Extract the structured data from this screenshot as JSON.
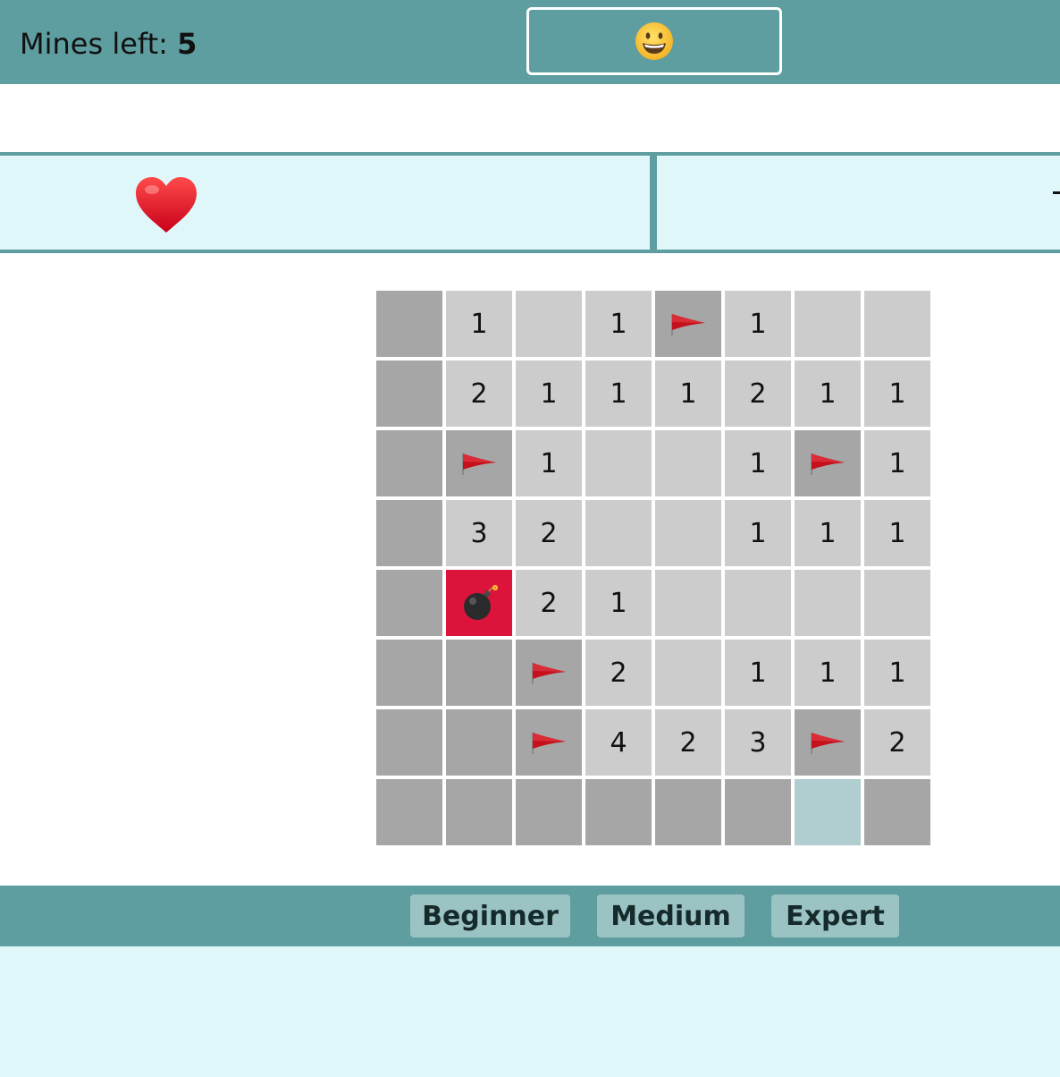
{
  "header": {
    "mines_left_label": "Mines left:",
    "mines_left_count": "5",
    "face_icon": "grinning-face-icon"
  },
  "status": {
    "lives_icon": "heart-icon",
    "lives": 1
  },
  "board": {
    "rows": 8,
    "cols": 8,
    "cells": [
      [
        {
          "s": "hidden",
          "v": ""
        },
        {
          "s": "revealed",
          "v": "1"
        },
        {
          "s": "revealed",
          "v": ""
        },
        {
          "s": "revealed",
          "v": "1"
        },
        {
          "s": "flag",
          "v": ""
        },
        {
          "s": "revealed",
          "v": "1"
        },
        {
          "s": "revealed",
          "v": ""
        },
        {
          "s": "revealed",
          "v": ""
        }
      ],
      [
        {
          "s": "hidden",
          "v": ""
        },
        {
          "s": "revealed",
          "v": "2"
        },
        {
          "s": "revealed",
          "v": "1"
        },
        {
          "s": "revealed",
          "v": "1"
        },
        {
          "s": "revealed",
          "v": "1"
        },
        {
          "s": "revealed",
          "v": "2"
        },
        {
          "s": "revealed",
          "v": "1"
        },
        {
          "s": "revealed",
          "v": "1"
        }
      ],
      [
        {
          "s": "hidden",
          "v": ""
        },
        {
          "s": "flag",
          "v": ""
        },
        {
          "s": "revealed",
          "v": "1"
        },
        {
          "s": "revealed",
          "v": ""
        },
        {
          "s": "revealed",
          "v": ""
        },
        {
          "s": "revealed",
          "v": "1"
        },
        {
          "s": "flag",
          "v": ""
        },
        {
          "s": "revealed",
          "v": "1"
        }
      ],
      [
        {
          "s": "hidden",
          "v": ""
        },
        {
          "s": "revealed",
          "v": "3"
        },
        {
          "s": "revealed",
          "v": "2"
        },
        {
          "s": "revealed",
          "v": ""
        },
        {
          "s": "revealed",
          "v": ""
        },
        {
          "s": "revealed",
          "v": "1"
        },
        {
          "s": "revealed",
          "v": "1"
        },
        {
          "s": "revealed",
          "v": "1"
        }
      ],
      [
        {
          "s": "hidden",
          "v": ""
        },
        {
          "s": "exploded",
          "v": ""
        },
        {
          "s": "revealed",
          "v": "2"
        },
        {
          "s": "revealed",
          "v": "1"
        },
        {
          "s": "revealed",
          "v": ""
        },
        {
          "s": "revealed",
          "v": ""
        },
        {
          "s": "revealed",
          "v": ""
        },
        {
          "s": "revealed",
          "v": ""
        }
      ],
      [
        {
          "s": "hidden",
          "v": ""
        },
        {
          "s": "hidden",
          "v": ""
        },
        {
          "s": "flag",
          "v": ""
        },
        {
          "s": "revealed",
          "v": "2"
        },
        {
          "s": "revealed",
          "v": ""
        },
        {
          "s": "revealed",
          "v": "1"
        },
        {
          "s": "revealed",
          "v": "1"
        },
        {
          "s": "revealed",
          "v": "1"
        }
      ],
      [
        {
          "s": "hidden",
          "v": ""
        },
        {
          "s": "hidden",
          "v": ""
        },
        {
          "s": "flag",
          "v": ""
        },
        {
          "s": "revealed",
          "v": "4"
        },
        {
          "s": "revealed",
          "v": "2"
        },
        {
          "s": "revealed",
          "v": "3"
        },
        {
          "s": "flag",
          "v": ""
        },
        {
          "s": "revealed",
          "v": "2"
        }
      ],
      [
        {
          "s": "hidden",
          "v": ""
        },
        {
          "s": "hidden",
          "v": ""
        },
        {
          "s": "hidden",
          "v": ""
        },
        {
          "s": "hidden",
          "v": ""
        },
        {
          "s": "hidden",
          "v": ""
        },
        {
          "s": "hidden",
          "v": ""
        },
        {
          "s": "hover",
          "v": ""
        },
        {
          "s": "hidden",
          "v": ""
        }
      ]
    ],
    "flag_icon": "red-flag-icon",
    "mine_icon": "bomb-icon"
  },
  "difficulty": {
    "buttons": [
      {
        "label": "Beginner"
      },
      {
        "label": "Medium"
      },
      {
        "label": "Expert"
      }
    ]
  }
}
